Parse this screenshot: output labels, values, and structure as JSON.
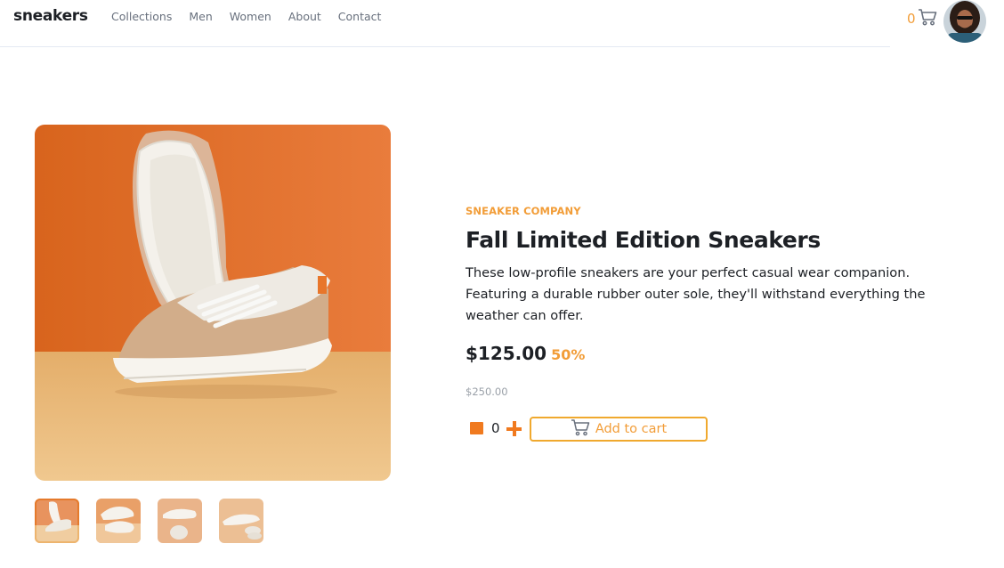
{
  "brand": {
    "logo": "sneakers"
  },
  "nav": {
    "items": [
      {
        "label": "Collections"
      },
      {
        "label": "Men"
      },
      {
        "label": "Women"
      },
      {
        "label": "About"
      },
      {
        "label": "Contact"
      }
    ]
  },
  "cart": {
    "count": "0",
    "icon": "cart-icon"
  },
  "user": {
    "avatar": "avatar"
  },
  "gallery": {
    "main_image": "sneaker-product-photo",
    "thumbnails_count": 4,
    "active_thumbnail": 1
  },
  "product": {
    "company": "SNEAKER COMPANY",
    "title": "Fall Limited Edition Sneakers",
    "description": "These low-profile sneakers are your perfect casual wear companion. Featuring a durable rubber outer sole, they'll withstand everything the weather can offer.",
    "price": "$125.00",
    "discount": "50%",
    "original_price": "$250.00"
  },
  "quantity": {
    "value": "0"
  },
  "actions": {
    "add_to_cart": "Add to cart"
  },
  "colors": {
    "accent": "#f29d38",
    "text": "#1d2025",
    "muted": "#68707d"
  }
}
